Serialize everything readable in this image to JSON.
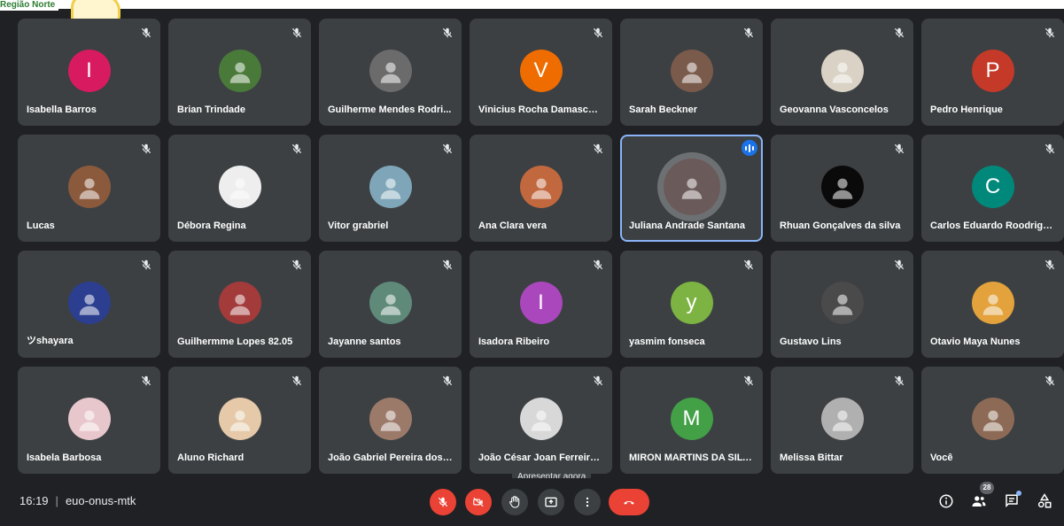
{
  "header": {
    "region_label": "Região Norte"
  },
  "participants": [
    {
      "name": "Isabella Barros",
      "initial": "I",
      "color": "#d81b60",
      "avatar": "initial"
    },
    {
      "name": "Brian Trindade",
      "avatar": "photo",
      "color": "#4a7a3a"
    },
    {
      "name": "Guilherme Mendes Rodri...",
      "avatar": "photo",
      "color": "#6b6b6b"
    },
    {
      "name": "Vinicius Rocha Damasceno",
      "initial": "V",
      "color": "#ef6c00",
      "avatar": "initial"
    },
    {
      "name": "Sarah Beckner",
      "avatar": "photo",
      "color": "#7a5a4a"
    },
    {
      "name": "Geovanna Vasconcelos",
      "avatar": "photo",
      "color": "#d9d2c5"
    },
    {
      "name": "Pedro Henrique",
      "initial": "P",
      "color": "#c53929",
      "avatar": "initial"
    },
    {
      "name": "Lucas",
      "avatar": "photo",
      "color": "#8b5a3c"
    },
    {
      "name": "Débora Regina",
      "avatar": "photo",
      "color": "#eeeeee"
    },
    {
      "name": "Vitor grabriel",
      "avatar": "photo",
      "color": "#7fa6b8"
    },
    {
      "name": "Ana Clara vera",
      "avatar": "photo",
      "color": "#c2683e"
    },
    {
      "name": "Juliana Andrade Santana",
      "avatar": "photo",
      "color": "#6b5a5a",
      "speaking": true
    },
    {
      "name": "Rhuan Gonçalves da silva",
      "avatar": "photo",
      "color": "#0a0a0a"
    },
    {
      "name": "Carlos Eduardo Roodrigu...",
      "initial": "C",
      "color": "#00897b",
      "avatar": "initial"
    },
    {
      "name": "ツshayara",
      "avatar": "photo",
      "color": "#2c3e8f"
    },
    {
      "name": "Guilhermme Lopes 82.05",
      "avatar": "photo",
      "color": "#a33b3b"
    },
    {
      "name": "Jayanne santos",
      "avatar": "photo",
      "color": "#5f8a7a"
    },
    {
      "name": "Isadora Ribeiro",
      "initial": "I",
      "color": "#ab47bc",
      "avatar": "initial"
    },
    {
      "name": "yasmim fonseca",
      "initial": "y",
      "color": "#7cb342",
      "avatar": "initial"
    },
    {
      "name": "Gustavo Lins",
      "avatar": "photo",
      "color": "#4a4a4a"
    },
    {
      "name": "Otavio Maya Nunes",
      "avatar": "photo",
      "color": "#e3a23b"
    },
    {
      "name": "Isabela Barbosa",
      "avatar": "photo",
      "color": "#e8c7cc"
    },
    {
      "name": "Aluno Richard",
      "avatar": "photo",
      "color": "#e5c9a8"
    },
    {
      "name": "João Gabriel Pereira dos ...",
      "avatar": "photo",
      "color": "#9c7a6a"
    },
    {
      "name": "João César Joan Ferreira I...",
      "avatar": "photo",
      "color": "#d8d8d8"
    },
    {
      "name": "MIRON MARTINS DA SILVA",
      "initial": "M",
      "color": "#43a047",
      "avatar": "initial"
    },
    {
      "name": "Melissa Bittar",
      "avatar": "photo",
      "color": "#b0b0b0"
    },
    {
      "name": "Você",
      "avatar": "photo",
      "color": "#8d6a55"
    }
  ],
  "bottom_bar": {
    "time": "16:19",
    "meeting_code": "euo-onus-mtk",
    "tooltip": "Apresentar agora",
    "participant_count": "28"
  },
  "colors": {
    "background": "#202124",
    "tile": "#3c4043",
    "danger": "#ea4335",
    "accent": "#8ab4f8"
  }
}
